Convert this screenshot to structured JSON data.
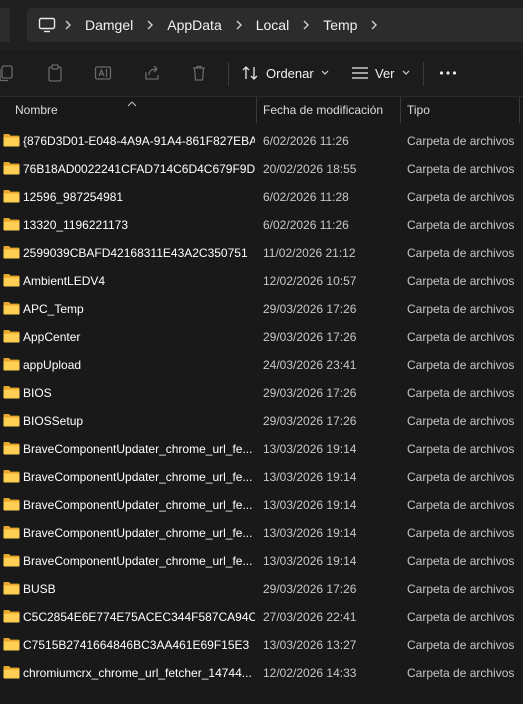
{
  "breadcrumb": {
    "icon": "this-pc-icon",
    "items": [
      "Damgel",
      "AppData",
      "Local",
      "Temp"
    ]
  },
  "toolbar": {
    "sort_label": "Ordenar",
    "view_label": "Ver",
    "icons": [
      "copy-icon",
      "paste-icon",
      "rename-icon",
      "share-icon",
      "delete-icon",
      "sort-icon",
      "view-icon",
      "more-icon"
    ]
  },
  "columns": {
    "name": "Nombre",
    "modified": "Fecha de modificación",
    "type": "Tipo"
  },
  "rows": [
    {
      "name": "{876D3D01-E048-4A9A-91A4-861F827EBA...",
      "date": "6/02/2026 11:26",
      "type": "Carpeta de archivos"
    },
    {
      "name": "76B18AD0022241CFAD714C6D4C679F9D",
      "date": "20/02/2026 18:55",
      "type": "Carpeta de archivos"
    },
    {
      "name": "12596_987254981",
      "date": "6/02/2026 11:28",
      "type": "Carpeta de archivos"
    },
    {
      "name": "13320_1196221173",
      "date": "6/02/2026 11:26",
      "type": "Carpeta de archivos"
    },
    {
      "name": "2599039CBAFD42168311E43A2C350751",
      "date": "11/02/2026 21:12",
      "type": "Carpeta de archivos"
    },
    {
      "name": "AmbientLEDV4",
      "date": "12/02/2026 10:57",
      "type": "Carpeta de archivos"
    },
    {
      "name": "APC_Temp",
      "date": "29/03/2026 17:26",
      "type": "Carpeta de archivos"
    },
    {
      "name": "AppCenter",
      "date": "29/03/2026 17:26",
      "type": "Carpeta de archivos"
    },
    {
      "name": "appUpload",
      "date": "24/03/2026 23:41",
      "type": "Carpeta de archivos"
    },
    {
      "name": "BIOS",
      "date": "29/03/2026 17:26",
      "type": "Carpeta de archivos"
    },
    {
      "name": "BIOSSetup",
      "date": "29/03/2026 17:26",
      "type": "Carpeta de archivos"
    },
    {
      "name": "BraveComponentUpdater_chrome_url_fe...",
      "date": "13/03/2026 19:14",
      "type": "Carpeta de archivos"
    },
    {
      "name": "BraveComponentUpdater_chrome_url_fe...",
      "date": "13/03/2026 19:14",
      "type": "Carpeta de archivos"
    },
    {
      "name": "BraveComponentUpdater_chrome_url_fe...",
      "date": "13/03/2026 19:14",
      "type": "Carpeta de archivos"
    },
    {
      "name": "BraveComponentUpdater_chrome_url_fe...",
      "date": "13/03/2026 19:14",
      "type": "Carpeta de archivos"
    },
    {
      "name": "BraveComponentUpdater_chrome_url_fe...",
      "date": "13/03/2026 19:14",
      "type": "Carpeta de archivos"
    },
    {
      "name": "BUSB",
      "date": "29/03/2026 17:26",
      "type": "Carpeta de archivos"
    },
    {
      "name": "C5C2854E6E774E75ACEC344F587CA94C",
      "date": "27/03/2026 22:41",
      "type": "Carpeta de archivos"
    },
    {
      "name": "C7515B2741664846BC3AA461E69F15E3",
      "date": "13/03/2026 13:27",
      "type": "Carpeta de archivos"
    },
    {
      "name": "chromiumcrx_chrome_url_fetcher_14744...",
      "date": "12/02/2026 14:33",
      "type": "Carpeta de archivos"
    }
  ],
  "colors": {
    "folder": "#f5c542",
    "background": "#191919",
    "text": "#ffffff",
    "muted_text": "#c8c8c8"
  }
}
